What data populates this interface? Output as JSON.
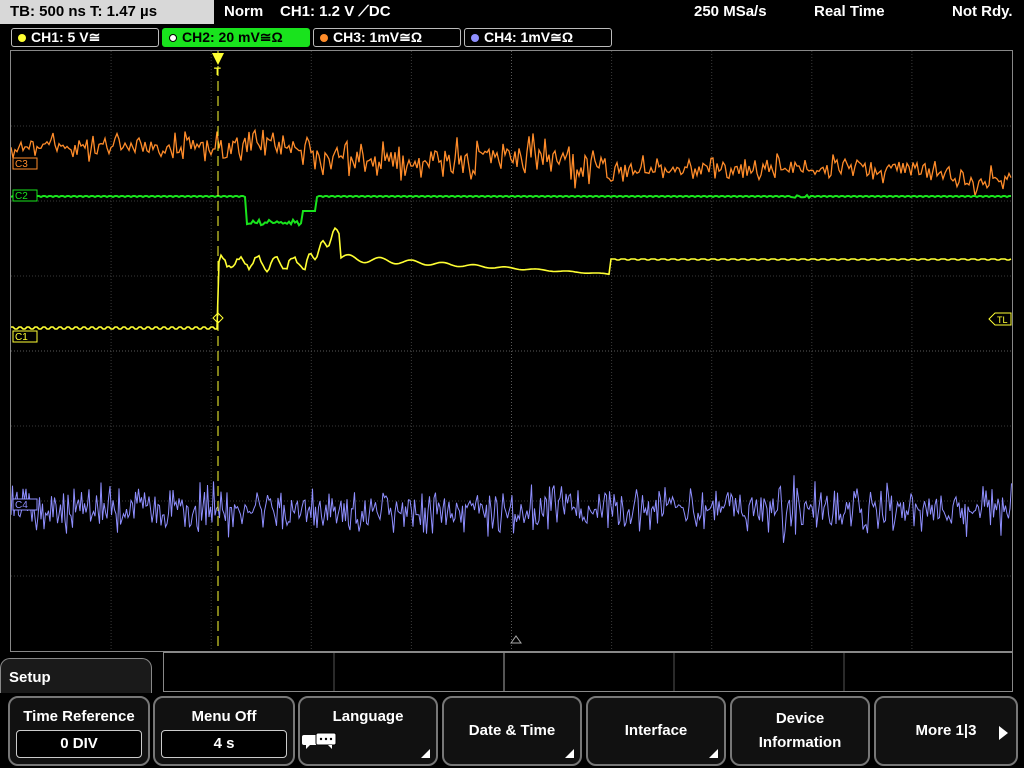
{
  "status_bar": {
    "timebase": "TB: 500 ns   T: 1.47 µs",
    "mode": "Norm",
    "trigger": "CH1: 1.2 V ⟋DC",
    "sample_rate": "250 MSa/s",
    "acq_mode": "Real Time",
    "state": "Not Rdy."
  },
  "channels": [
    {
      "label": "CH1: 5 V≅",
      "color": "#ffff33",
      "active": false
    },
    {
      "label": "CH2: 20 mV≅Ω",
      "color": "#19e31d",
      "active": true
    },
    {
      "label": "CH3: 1mV≅Ω",
      "color": "#ff8c2a",
      "active": false
    },
    {
      "label": "CH4: 1mV≅Ω",
      "color": "#8f8fff",
      "active": false
    }
  ],
  "markers": {
    "ch3": "C3",
    "ch2": "C2",
    "ch1": "C1",
    "ch4": "C4",
    "trigger_level": "TL",
    "trigger_pos": "T"
  },
  "menu": {
    "title": "Setup",
    "softkeys": [
      {
        "label": "Time Reference",
        "value": "0 DIV"
      },
      {
        "label": "Menu Off",
        "value": "4 s"
      },
      {
        "label": "Language",
        "icon": "speech-bubbles-icon"
      },
      {
        "label": "Date & Time"
      },
      {
        "label": "Interface"
      },
      {
        "label": "Device",
        "label2": "Information"
      },
      {
        "label": "More 1|3"
      }
    ]
  },
  "colors": {
    "ch1": "#ffff33",
    "ch2": "#19e31d",
    "ch3": "#ff8c2a",
    "ch4": "#8f8fff",
    "grid": "#555555"
  }
}
